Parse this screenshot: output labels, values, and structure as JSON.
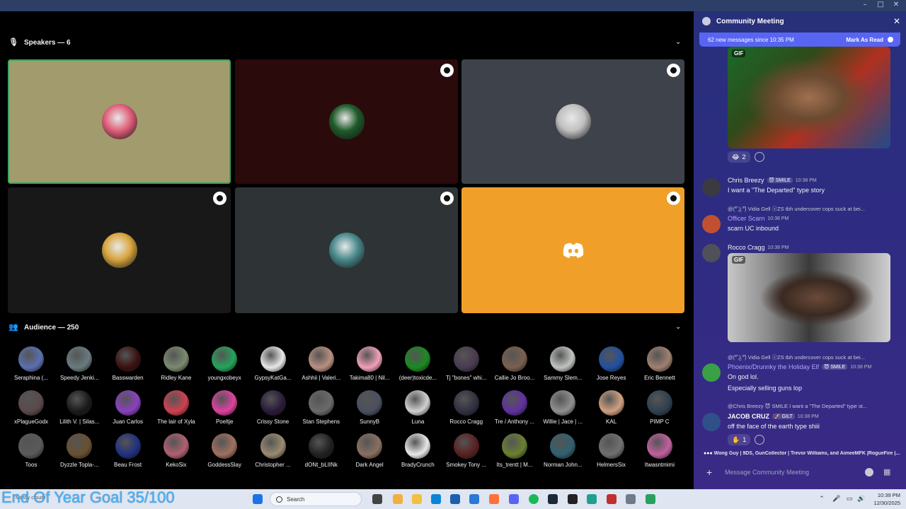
{
  "window": {
    "controls": [
      "–",
      "□",
      "✕"
    ]
  },
  "stage": {
    "speakers_header": "Speakers — 6",
    "audience_header": "Audience — 250",
    "speaker_tiles": [
      {
        "bg": "#a29b6e",
        "active": true,
        "pinned": false,
        "avatar_color": "#e0607a"
      },
      {
        "bg": "#2b0a0c",
        "active": false,
        "pinned": true,
        "avatar_color": "#1f5a2a"
      },
      {
        "bg": "#3e434b",
        "active": false,
        "pinned": true,
        "avatar_color": "#c0c0c0"
      },
      {
        "bg": "#181818",
        "active": false,
        "pinned": true,
        "avatar_color": "#d9a640"
      },
      {
        "bg": "#2e3336",
        "active": false,
        "pinned": true,
        "avatar_color": "#4a8a8c"
      },
      {
        "bg": "#f0a028",
        "active": false,
        "pinned": true,
        "avatar_color": "discord"
      }
    ],
    "audience": [
      {
        "name": "Seraphina (...",
        "color": "#5a6fb0"
      },
      {
        "name": "Speedy Jenki...",
        "color": "#6a7a80"
      },
      {
        "name": "Basswarden",
        "color": "#3a1010"
      },
      {
        "name": "Ridley Kane",
        "color": "#7a8a70"
      },
      {
        "name": "youngxobeyx",
        "color": "#23a55a"
      },
      {
        "name": "GypsyKatGa...",
        "color": "#e8e8e8"
      },
      {
        "name": "Ashhii | Valeri...",
        "color": "#b89080"
      },
      {
        "name": "Takima80 | Nil...",
        "color": "#f0a0b8"
      },
      {
        "name": "(deer)toxicde...",
        "color": "#1a8a20"
      },
      {
        "name": "Tj \"bones\" whi...",
        "color": "#4a3a50"
      },
      {
        "name": "Callie Jo Broo...",
        "color": "#7a6050"
      },
      {
        "name": "Sammy Slem...",
        "color": "#c0c4c0"
      },
      {
        "name": "Jose Reyes",
        "color": "#2050a0"
      },
      {
        "name": "Eric Bennett",
        "color": "#a08070"
      },
      {
        "name": "xPlagueGodx",
        "color": "#5a4a4a"
      },
      {
        "name": "Lilith V. | Silas...",
        "color": "#1a1a1a"
      },
      {
        "name": "Juan Carlos",
        "color": "#8a40c0"
      },
      {
        "name": "The lair of Xyla",
        "color": "#d04050"
      },
      {
        "name": "Poeltje",
        "color": "#e040a0"
      },
      {
        "name": "Crissy Stone",
        "color": "#2a1a3a"
      },
      {
        "name": "Stan Stephens",
        "color": "#6a6a6a"
      },
      {
        "name": "SunnyB",
        "color": "#4a5060"
      },
      {
        "name": "Luna",
        "color": "#d0d0d0"
      },
      {
        "name": "Rocco Cragg",
        "color": "#303040"
      },
      {
        "name": "Tre / Anthony ...",
        "color": "#6030a0"
      },
      {
        "name": "Willie | Jace | ...",
        "color": "#909090"
      },
      {
        "name": "KAL",
        "color": "#d0a080"
      },
      {
        "name": "PIMP C",
        "color": "#304050"
      },
      {
        "name": "Toos",
        "color": "#5a5a5a"
      },
      {
        "name": "Dyzzle Topla-...",
        "color": "#6a5030"
      },
      {
        "name": "Beau Frost",
        "color": "#203080"
      },
      {
        "name": "KekoSix",
        "color": "#b06070"
      },
      {
        "name": "GoddessSlay",
        "color": "#a07060"
      },
      {
        "name": "Christopher ...",
        "color": "#9a8a70"
      },
      {
        "name": "dONt_bLIINk",
        "color": "#202020"
      },
      {
        "name": "Dark Angel",
        "color": "#8a7060"
      },
      {
        "name": "BradyCrunch",
        "color": "#e8e8e8"
      },
      {
        "name": "Smokey Tony ...",
        "color": "#5a2020"
      },
      {
        "name": "Its_trentt | M...",
        "color": "#6a8030"
      },
      {
        "name": "Norman John...",
        "color": "#306070"
      },
      {
        "name": "HelmersSix",
        "color": "#707070"
      },
      {
        "name": "Itwasntmimi",
        "color": "#c060a0"
      }
    ]
  },
  "overlay": {
    "goal_text": "End Of Year Goal 35/100"
  },
  "chat": {
    "title": "Community Meeting",
    "new_messages": "62 new messages since 10:35 PM",
    "mark_as_read": "Mark As Read",
    "gif_label": "GIF",
    "reaction1": {
      "emoji": "😂",
      "count": "2"
    },
    "reaction2": {
      "emoji": "✋",
      "count": "1"
    },
    "messages": [
      {
        "user": "Chris Breezy",
        "color": "#f2f3f5",
        "badge": "😈 SMILE",
        "time": "10:38 PM",
        "text": "I want a \"The Departed\" type story"
      },
      {
        "reply": "@(͡° ͜ʖ ͡°) Vidia Gell  ⓩZS  tbh undercover cops suck at bei...",
        "user": "Officer Scarn",
        "color": "#b9a3ff",
        "badge": "",
        "time": "10:38 PM",
        "text": "scarn UC inbound"
      },
      {
        "user": "Rocco Cragg",
        "color": "#f2f3f5",
        "badge": "",
        "time": "10:38 PM",
        "text": ""
      },
      {
        "reply": "@(͡° ͜ʖ ͡°) Vidia Gell  ⓩZS  tbh undercover cops suck at bei...",
        "user": "Phoenix/Drunnky the Holiday Elf",
        "color": "#b9a3ff",
        "badge": "😈 SMILE",
        "time": "10:38 PM",
        "text": "On god lol.",
        "text2": "Especially selling guns lop"
      },
      {
        "reply": "@Chris Breezy  😈 SMILE  I want a \"The Departed\" type st...",
        "user": "JACOB CRUZ",
        "color": "#ffffff",
        "badge": "🚀 GILT",
        "time": "10:38 PM",
        "text": "off the face of the earth type shiii"
      }
    ],
    "typing": "Wong Guy | 9DS, GunCollector | Trevor Williams, and AimeeMFK |RogueFire |...",
    "composer_placeholder": "Message Community Meeting"
  },
  "taskbar": {
    "search_label": "Search",
    "weather_text": "Mostly cloudy",
    "time": "10:39 PM",
    "date": "12/30/2025"
  }
}
